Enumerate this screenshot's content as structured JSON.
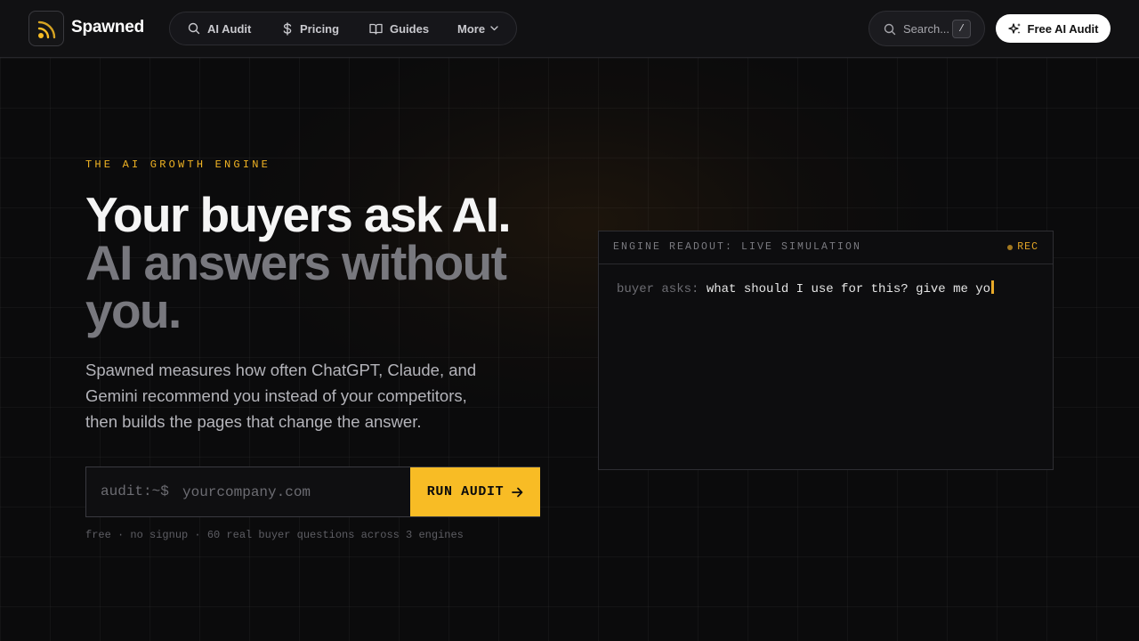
{
  "colors": {
    "accent": "#f8bc25",
    "background": "#0b0b0c",
    "header_bg": "#111113",
    "muted_heading": "#78787e"
  },
  "header": {
    "brand": "Spawned",
    "logo_icon": "rss-signal-icon",
    "nav": [
      {
        "label": "AI Audit",
        "icon": "search-icon"
      },
      {
        "label": "Pricing",
        "icon": "dollar-icon"
      },
      {
        "label": "Guides",
        "icon": "book-icon"
      },
      {
        "label": "More",
        "icon": "chevron-down-icon"
      }
    ],
    "search": {
      "placeholder": "Search...",
      "shortcut": "/"
    },
    "cta_label": "Free AI Audit"
  },
  "hero": {
    "eyebrow": "THE AI GROWTH ENGINE",
    "headline_line1": "Your buyers ask AI.",
    "headline_line2": "AI answers without you.",
    "subheadline": "Spawned measures how often ChatGPT, Claude, and Gemini recommend you instead of your competitors, then builds the pages that change the answer.",
    "form": {
      "prompt": "audit:~$",
      "placeholder": "yourcompany.com",
      "button_label": "RUN AUDIT"
    },
    "fine_print": "free · no signup · 60 real buyer questions across 3 engines"
  },
  "terminal": {
    "title": "ENGINE READOUT: LIVE SIMULATION",
    "status": "REC",
    "line_label": "buyer asks:",
    "line_text": "what should I use for this? give me yo"
  }
}
